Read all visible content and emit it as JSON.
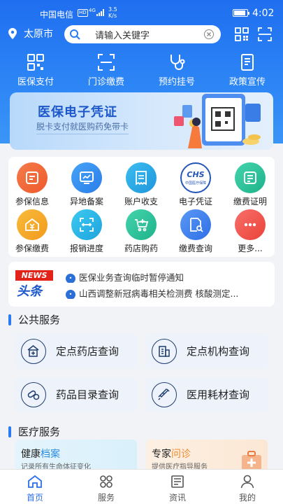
{
  "status_bar": {
    "carrier": "中国电信",
    "hd": "HD",
    "network": "4G",
    "speed_value": "3.5",
    "speed_unit": "K/s",
    "time": "4:02"
  },
  "top_bar": {
    "city": "太原市",
    "search_placeholder": "请输入关键字"
  },
  "quick_actions": [
    {
      "label": "医保支付",
      "icon": "qr-code-icon"
    },
    {
      "label": "门诊缴费",
      "icon": "scan-frame-icon"
    },
    {
      "label": "预约挂号",
      "icon": "stethoscope-icon"
    },
    {
      "label": "政策宣传",
      "icon": "document-icon"
    }
  ],
  "banner": {
    "title": "医保电子凭证",
    "subtitle": "脱卡支付就医购药免带卡"
  },
  "service_grid": [
    {
      "label": "参保信息",
      "icon": "insurance-info-icon",
      "color": "#f2693a"
    },
    {
      "label": "异地备案",
      "icon": "monitor-chart-icon",
      "color": "#2f8ff0"
    },
    {
      "label": "账户收支",
      "icon": "receipt-icon",
      "color": "#2aa3e8"
    },
    {
      "label": "电子凭证",
      "icon": "chs-logo-icon",
      "color": "#2456b8",
      "logo_text": "CHS",
      "logo_sub": "中国医疗保障"
    },
    {
      "label": "缴费证明",
      "icon": "certificate-icon",
      "color": "#2bc39b"
    },
    {
      "label": "参保缴费",
      "icon": "yuan-house-icon",
      "color": "#f5a623"
    },
    {
      "label": "报销进度",
      "icon": "scan-arrows-icon",
      "color": "#29b6e6"
    },
    {
      "label": "药店购药",
      "icon": "pharmacy-cart-icon",
      "color": "#2bc39b"
    },
    {
      "label": "缴费查询",
      "icon": "doc-search-icon",
      "color": "#3a7ef0"
    },
    {
      "label": "更多...",
      "icon": "more-dots-icon",
      "color": "#f05a4f"
    }
  ],
  "news": {
    "logo_top": "NEWS",
    "logo_bottom": "头条",
    "items": [
      {
        "text": "医保业务查询临时暂停通知"
      },
      {
        "text": "山西调整新冠病毒相关检测费 核酸测定..."
      }
    ]
  },
  "public_services": {
    "title": "公共服务",
    "items": [
      {
        "label": "定点药店查询",
        "icon": "pharmacy-icon"
      },
      {
        "label": "定点机构查询",
        "icon": "hospital-building-icon"
      },
      {
        "label": "药品目录查询",
        "icon": "pills-icon"
      },
      {
        "label": "医用耗材查询",
        "icon": "syringe-icon"
      }
    ]
  },
  "medical_services": {
    "title": "医疗服务",
    "items": [
      {
        "title_a": "健康",
        "title_b": "档案",
        "sub": "记录所有生命体征变化"
      },
      {
        "title_a": "专家",
        "title_b": "问诊",
        "sub": "提供医疗指导服务"
      }
    ]
  },
  "tab_bar": [
    {
      "label": "首页",
      "icon": "home-icon",
      "active": true
    },
    {
      "label": "服务",
      "icon": "grid-petals-icon"
    },
    {
      "label": "资讯",
      "icon": "newspaper-icon"
    },
    {
      "label": "我的",
      "icon": "user-icon"
    }
  ],
  "colors": {
    "primary": "#1f6ef0",
    "accent_text": "#1c58c9",
    "page_bg": "#f2f3f7",
    "active_tab": "#2c6fe8"
  }
}
